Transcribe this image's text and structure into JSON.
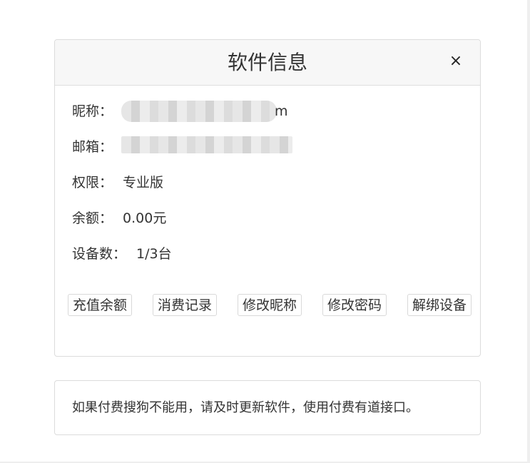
{
  "dialog": {
    "title": "软件信息",
    "close_label": "×"
  },
  "info": {
    "nickname": {
      "label": "昵称：",
      "value_visible_tail": "m"
    },
    "email": {
      "label": "邮箱："
    },
    "permission": {
      "label": "权限：",
      "value": "专业版"
    },
    "balance": {
      "label": "余额：",
      "value": "0.00元"
    },
    "devices": {
      "label": "设备数：",
      "value": "1/3台"
    }
  },
  "actions": [
    {
      "label": "充值余额"
    },
    {
      "label": "消费记录"
    },
    {
      "label": "修改昵称"
    },
    {
      "label": "修改密码"
    },
    {
      "label": "解绑设备"
    }
  ],
  "notice": {
    "text": "如果付费搜狗不能用，请及时更新软件，使用付费有道接口。"
  }
}
